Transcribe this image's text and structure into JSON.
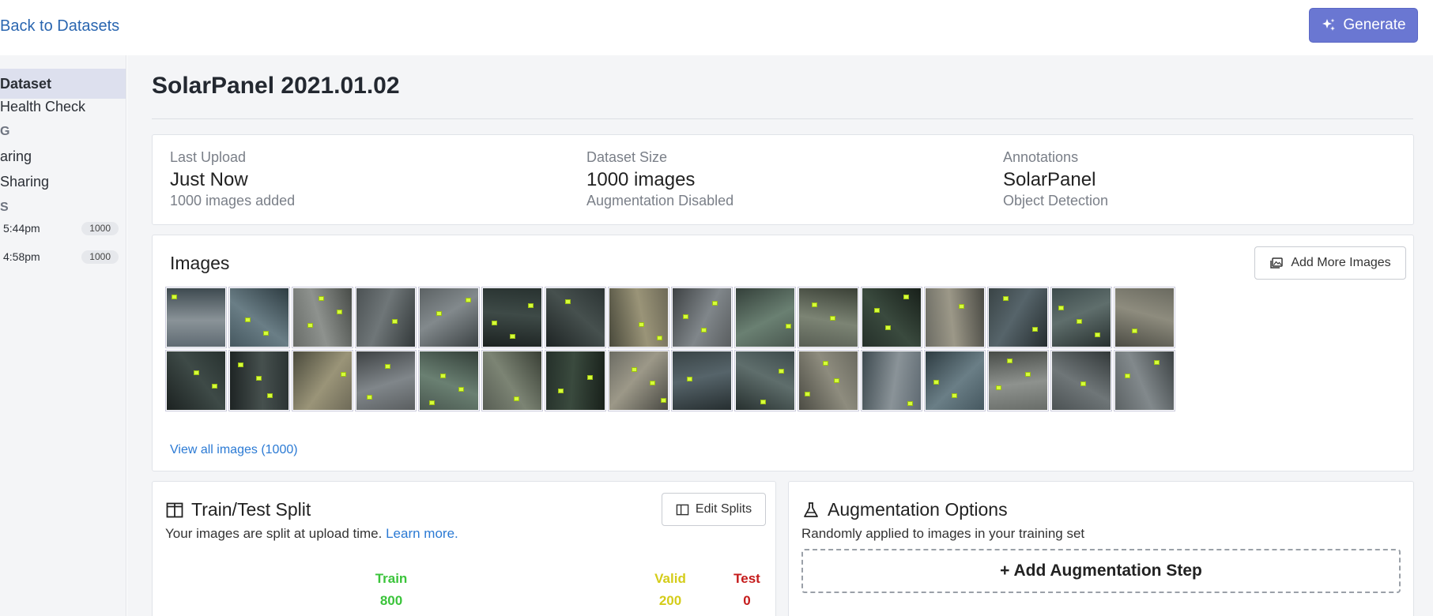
{
  "topbar": {
    "back_label": "Back to Datasets",
    "generate_label": "Generate"
  },
  "sidebar": {
    "items": [
      {
        "label": "Dataset",
        "active": true
      },
      {
        "label": "Health Check",
        "active": false
      }
    ],
    "section_a": "G",
    "sharing_items": [
      {
        "label": "aring"
      },
      {
        "label": " Sharing"
      }
    ],
    "section_b": "S",
    "versions": [
      {
        "time": "5:44pm",
        "count": "1000"
      },
      {
        "time": "4:58pm",
        "count": "1000"
      }
    ]
  },
  "main": {
    "title": "SolarPanel 2021.01.02",
    "stats": [
      {
        "label": "Last Upload",
        "value": "Just Now",
        "sub": "1000 images added"
      },
      {
        "label": "Dataset Size",
        "value": "1000 images",
        "sub": "Augmentation Disabled"
      },
      {
        "label": "Annotations",
        "value": "SolarPanel",
        "sub": "Object Detection"
      }
    ],
    "images": {
      "title": "Images",
      "add_button": "Add More Images",
      "view_all": "View all images (1000)",
      "thumb_count": 32
    },
    "split": {
      "title": "Train/Test Split",
      "subtitle": "Your images are split at upload time.",
      "learn_more": "Learn more.",
      "edit_button": "Edit Splits",
      "train_label": "Train",
      "train_value": "800",
      "valid_label": "Valid",
      "valid_value": "200",
      "test_label": "Test",
      "test_value": "0"
    },
    "augmentation": {
      "title": "Augmentation Options",
      "subtitle": "Randomly applied to images in your training set",
      "add_step": "+ Add Augmentation Step"
    }
  },
  "colors": {
    "accent": "#6a77d2",
    "link": "#2b7ad4",
    "train": "#3bc43b",
    "valid": "#d4cc19",
    "test": "#c51b1b"
  }
}
